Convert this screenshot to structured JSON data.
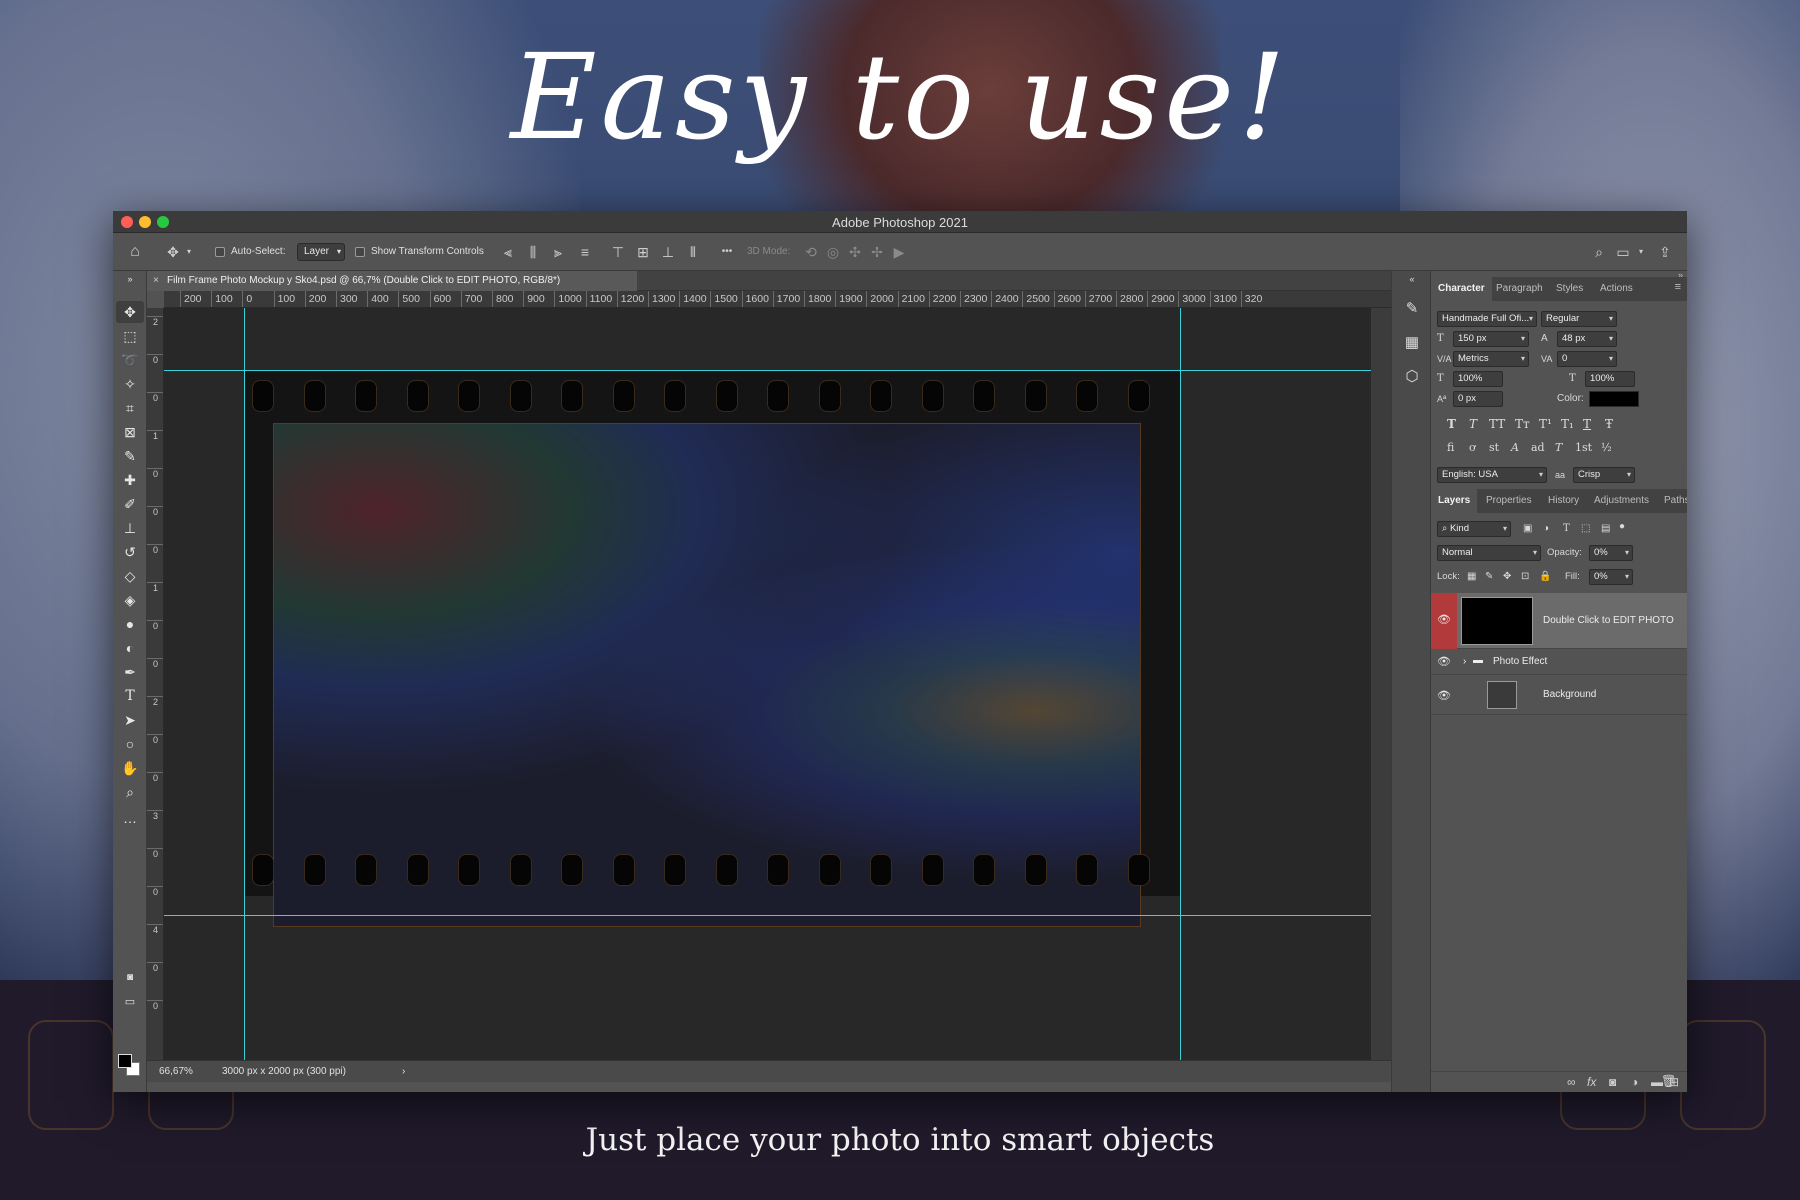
{
  "promo": {
    "headline": "Easy to use!",
    "caption": "Just place your photo into smart objects"
  },
  "window": {
    "title": "Adobe Photoshop 2021",
    "traffic_colors": [
      "#ff5f57",
      "#febc2e",
      "#28c840"
    ]
  },
  "options_bar": {
    "auto_select_label": "Auto-Select:",
    "auto_select_value": "Layer",
    "show_transform_label": "Show Transform Controls",
    "three_d_label": "3D Mode:",
    "more_glyph": "•••"
  },
  "document": {
    "tab_title": "Film Frame Photo Mockup y Sko4.psd @ 66,7% (Double Click to EDIT PHOTO, RGB/8*)",
    "close_glyph": "×",
    "ruler_labels": [
      "200",
      "100",
      "0",
      "100",
      "200",
      "300",
      "400",
      "500",
      "600",
      "700",
      "800",
      "900",
      "1000",
      "1100",
      "1200",
      "1300",
      "1400",
      "1500",
      "1600",
      "1700",
      "1800",
      "1900",
      "2000",
      "2100",
      "2200",
      "2300",
      "2400",
      "2500",
      "2600",
      "2700",
      "2800",
      "2900",
      "3000",
      "3100",
      "320"
    ],
    "vruler_labels": [
      "2",
      "0",
      "0",
      "1",
      "0",
      "0",
      "0",
      "1",
      "0",
      "0",
      "2",
      "0",
      "0",
      "3",
      "0",
      "0",
      "4",
      "0",
      "0"
    ]
  },
  "status": {
    "zoom": "66,67%",
    "doc_info": "3000 px x 2000 px (300 ppi)",
    "arrow": "›"
  },
  "character": {
    "tabs": [
      "Character",
      "Paragraph",
      "Styles",
      "Actions"
    ],
    "font_family": "Handmade Full Ofi...",
    "font_style": "Regular",
    "font_size": "150 px",
    "leading": "48 px",
    "kerning": "Metrics",
    "tracking": "0",
    "vscale": "100%",
    "hscale": "100%",
    "baseline": "0 px",
    "color_label": "Color:",
    "text_color": "#000000",
    "language": "English: USA",
    "aa_glyph": "aa",
    "antialias": "Crisp",
    "style_buttons": [
      "T",
      "T",
      "TT",
      "Tт",
      "T¹",
      "T₁",
      "T",
      "Ŧ"
    ],
    "opentype_buttons": [
      "fi",
      "ơ",
      "st",
      "A",
      "ad",
      "T",
      "1st",
      "½"
    ]
  },
  "layers": {
    "tabs": [
      "Layers",
      "Properties",
      "History",
      "Adjustments",
      "Paths"
    ],
    "filter_kind": "Kind",
    "blend_mode": "Normal",
    "opacity_label": "Opacity:",
    "opacity": "0%",
    "lock_label": "Lock:",
    "fill_label": "Fill:",
    "fill": "0%",
    "items": [
      {
        "name": "Double Click to EDIT PHOTO",
        "selected": true
      },
      {
        "name": "Photo Effect",
        "selected": false
      },
      {
        "name": "Background",
        "selected": false
      }
    ]
  },
  "icons": {
    "home": "home-icon",
    "move": "move-icon",
    "search": "search-icon",
    "workspace": "workspace-icon",
    "share": "share-icon",
    "eye": "eye-icon",
    "folder": "folder-icon"
  }
}
